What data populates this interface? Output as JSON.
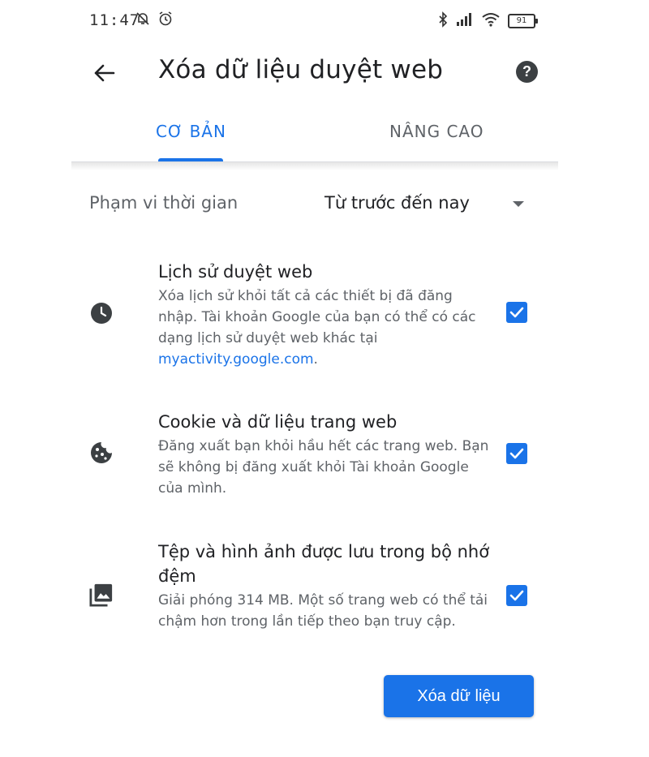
{
  "status_bar": {
    "time": "11:47",
    "battery": "91",
    "icons": [
      "muted-alarm-icon",
      "alarm-clock-icon",
      "bluetooth-icon",
      "signal-icon",
      "wifi-icon",
      "battery-icon"
    ]
  },
  "toolbar": {
    "title": "Xóa dữ liệu duyệt web",
    "back_icon": "arrow-left-icon",
    "help_icon": "help-icon",
    "help_label": "?"
  },
  "tabs": [
    {
      "label": "CƠ BẢN",
      "selected": true
    },
    {
      "label": "NÂNG CAO",
      "selected": false
    }
  ],
  "time_range": {
    "label": "Phạm vi thời gian",
    "value": "Từ trước đến nay"
  },
  "items": [
    {
      "icon": "clock-icon",
      "title": "Lịch sử duyệt web",
      "description": "Xóa lịch sử khỏi tất cả các thiết bị đã đăng nhập. Tài khoản Google của bạn có thể có các dạng lịch sử duyệt web khác tại ",
      "link": "myactivity.google.com",
      "link_suffix": ".",
      "checked": true
    },
    {
      "icon": "cookie-icon",
      "title": "Cookie và dữ liệu trang web",
      "description": "Đăng xuất bạn khỏi hầu hết các trang web. Bạn sẽ không bị đăng xuất khỏi Tài khoản Google của mình.",
      "checked": true
    },
    {
      "icon": "images-icon",
      "title": "Tệp và hình ảnh được lưu trong bộ nhớ đệm",
      "description": "Giải phóng 314 MB. Một số trang web có thể tải chậm hơn trong lần tiếp theo bạn truy cập.",
      "checked": true
    }
  ],
  "clear_button": {
    "label": "Xóa dữ liệu"
  },
  "colors": {
    "accent": "#1a73e8",
    "text_primary": "#202124",
    "text_secondary": "#5f6368"
  }
}
